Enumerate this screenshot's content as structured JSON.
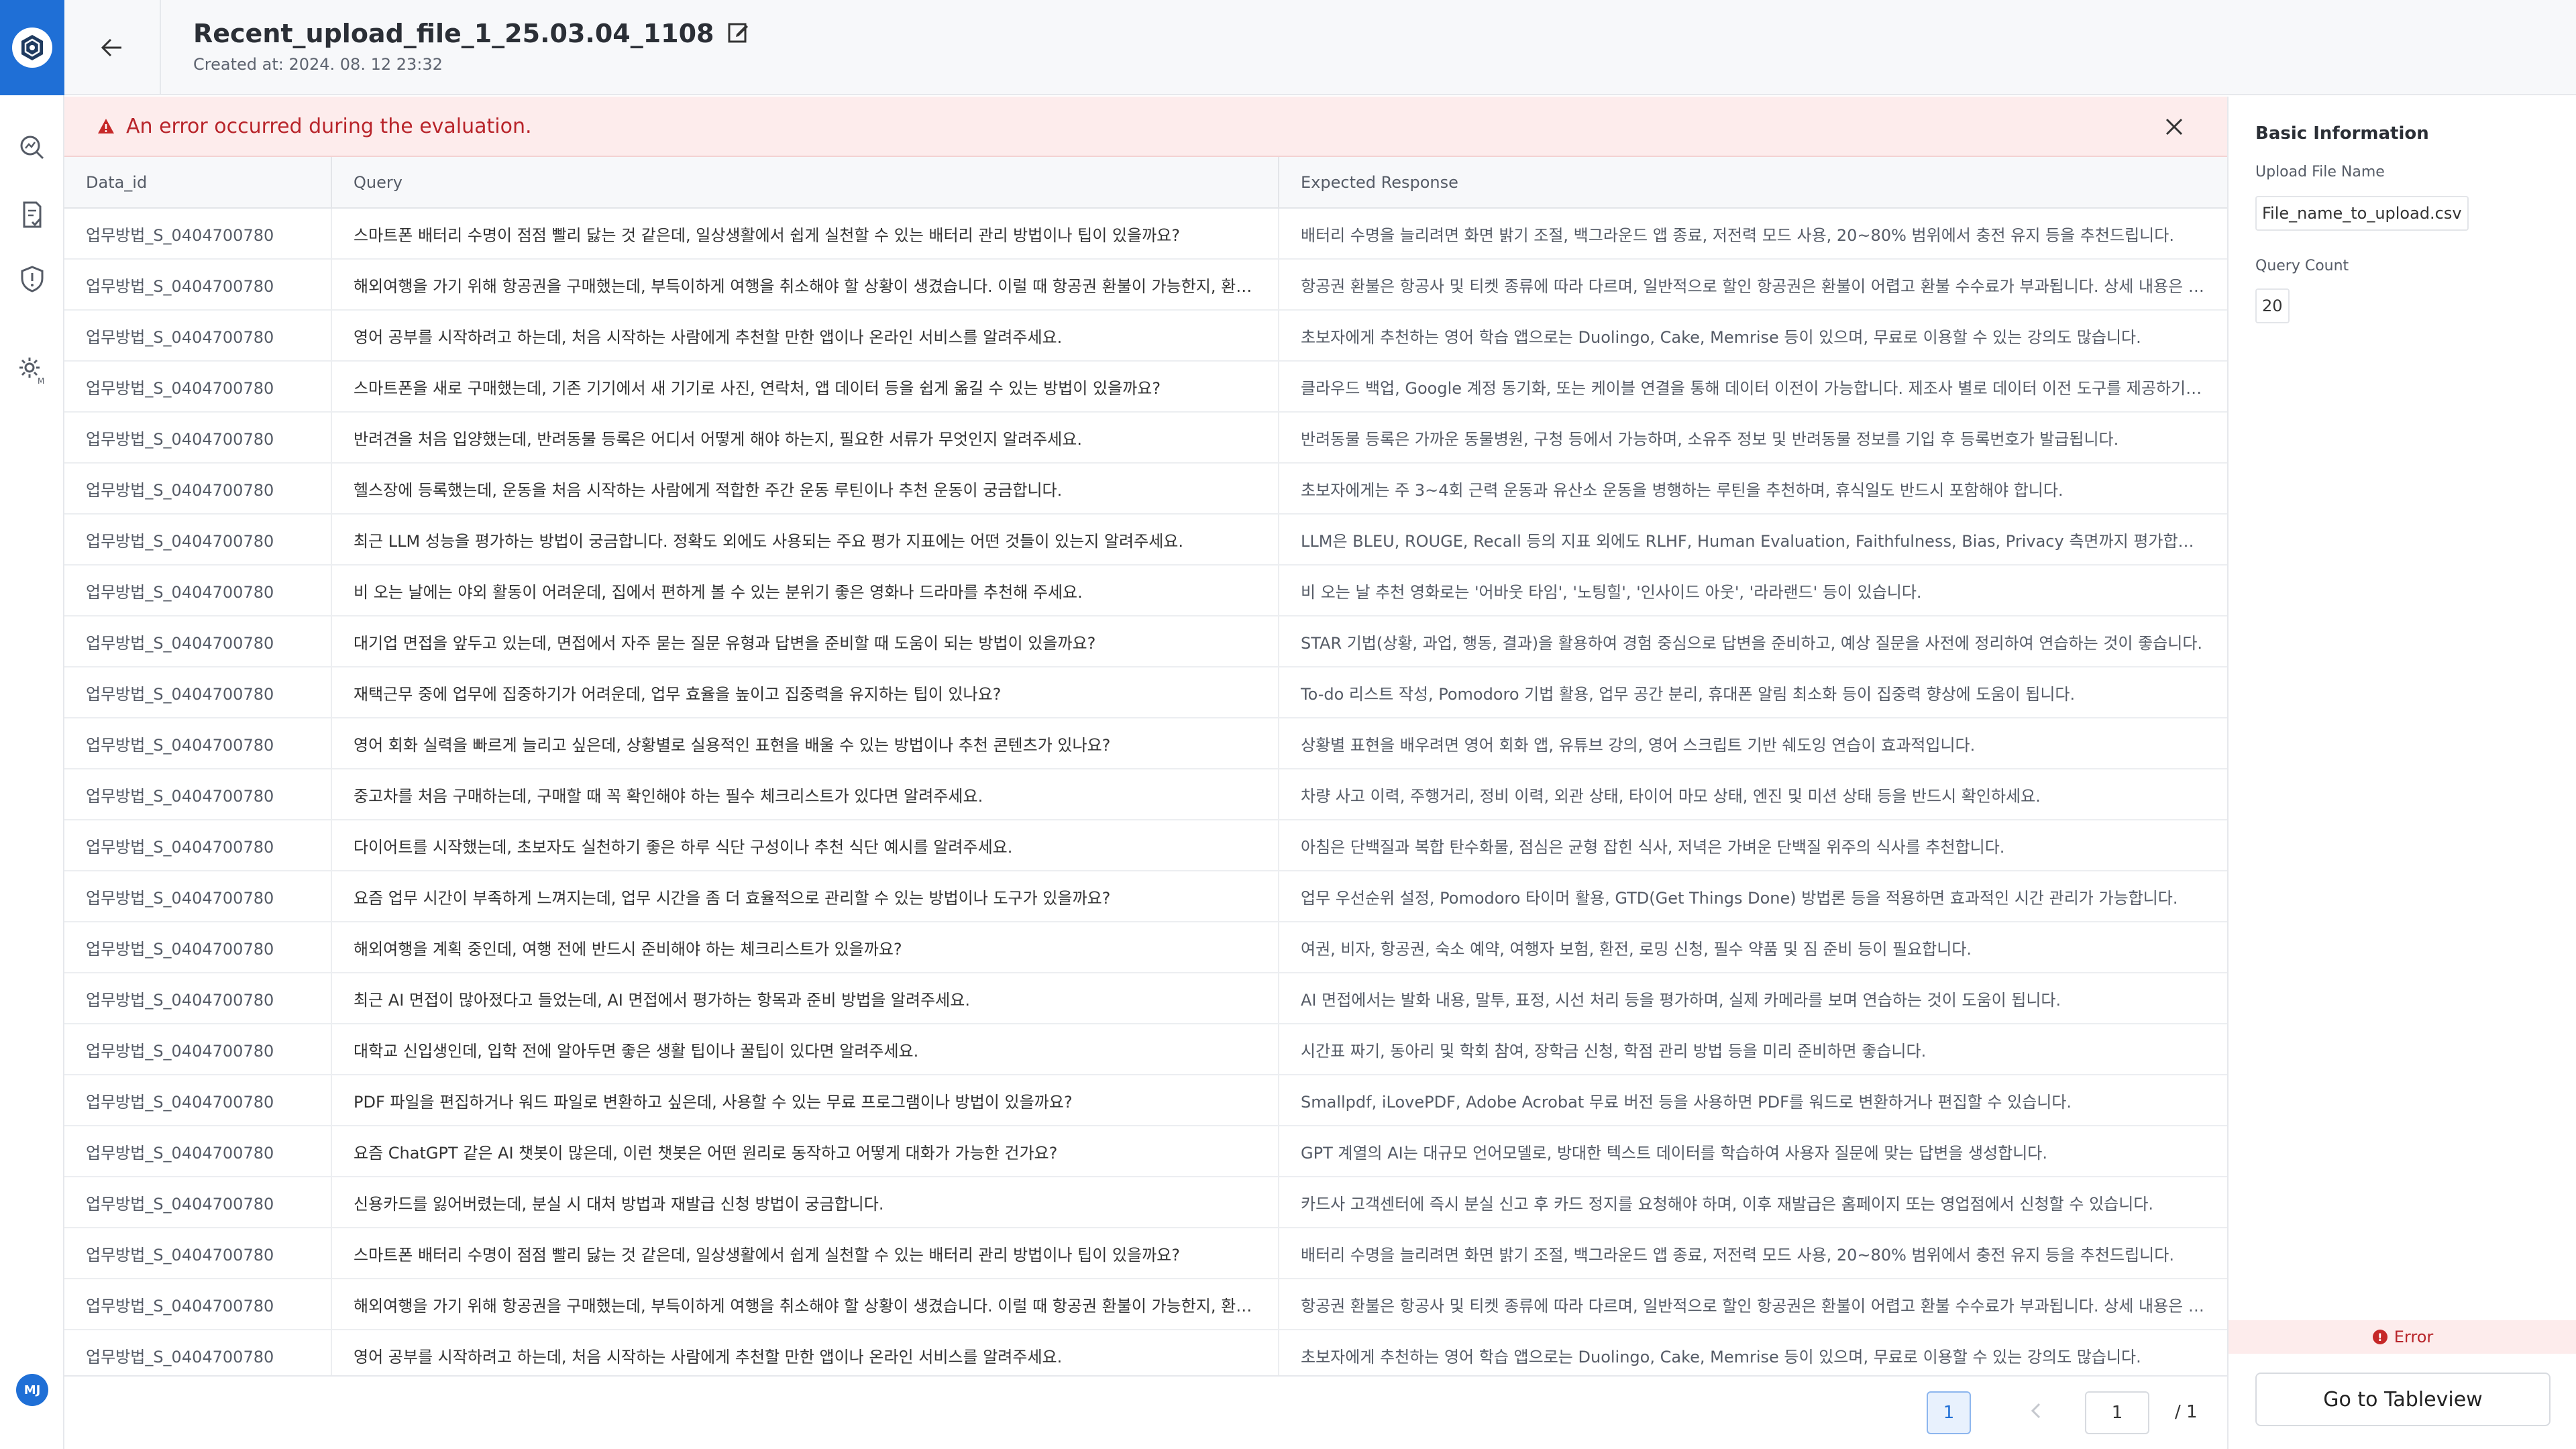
{
  "header": {
    "title": "Recent_upload_file_1_25.03.04_1108",
    "created_at": "Created at: 2024. 08. 12 23:32"
  },
  "error_banner": {
    "message": "An error occurred during the evaluation."
  },
  "table": {
    "columns": [
      "Data_id",
      "Query",
      "Expected Response"
    ],
    "rows": [
      {
        "id": "업무방법_S_0404700780",
        "query": "스마트폰 배터리 수명이 점점 빨리 닳는 것 같은데, 일상생활에서 쉽게 실천할 수 있는 배터리 관리 방법이나 팁이 있을까요?",
        "response": "배터리 수명을 늘리려면 화면 밝기 조절, 백그라운드 앱 종료, 저전력 모드 사용, 20~80% 범위에서 충전 유지 등을 추천드립니다."
      },
      {
        "id": "업무방법_S_0404700780",
        "query": "해외여행을 가기 위해 항공권을 구매했는데, 부득이하게 여행을 취소해야 할 상황이 생겼습니다. 이럴 때 항공권 환불이 가능한지, 환불 수…",
        "response": "항공권 환불은 항공사 및 티켓 종류에 따라 다르며, 일반적으로 할인 항공권은 환불이 어렵고 환불 수수료가 부과됩니다. 상세 내용은 구매…"
      },
      {
        "id": "업무방법_S_0404700780",
        "query": "영어 공부를 시작하려고 하는데, 처음 시작하는 사람에게 추천할 만한 앱이나 온라인 서비스를 알려주세요.",
        "response": "초보자에게 추천하는 영어 학습 앱으로는 Duolingo, Cake, Memrise 등이 있으며, 무료로 이용할 수 있는 강의도 많습니다."
      },
      {
        "id": "업무방법_S_0404700780",
        "query": "스마트폰을 새로 구매했는데, 기존 기기에서 새 기기로 사진, 연락처, 앱 데이터 등을 쉽게 옮길 수 있는 방법이 있을까요?",
        "response": "클라우드 백업, Google 계정 동기화, 또는 케이블 연결을 통해 데이터 이전이 가능합니다. 제조사 별로 데이터 이전 도구를 제공하기도 합…"
      },
      {
        "id": "업무방법_S_0404700780",
        "query": "반려견을 처음 입양했는데, 반려동물 등록은 어디서 어떻게 해야 하는지, 필요한 서류가 무엇인지 알려주세요.",
        "response": "반려동물 등록은 가까운 동물병원, 구청 등에서 가능하며, 소유주 정보 및 반려동물 정보를 기입 후 등록번호가 발급됩니다."
      },
      {
        "id": "업무방법_S_0404700780",
        "query": "헬스장에 등록했는데, 운동을 처음 시작하는 사람에게 적합한 주간 운동 루틴이나 추천 운동이 궁금합니다.",
        "response": "초보자에게는 주 3~4회 근력 운동과 유산소 운동을 병행하는 루틴을 추천하며, 휴식일도 반드시 포함해야 합니다."
      },
      {
        "id": "업무방법_S_0404700780",
        "query": "최근 LLM 성능을 평가하는 방법이 궁금합니다. 정확도 외에도 사용되는 주요 평가 지표에는 어떤 것들이 있는지 알려주세요.",
        "response": "LLM은 BLEU, ROUGE, Recall 등의 지표 외에도 RLHF, Human Evaluation, Faithfulness, Bias, Privacy 측면까지 평가합니다."
      },
      {
        "id": "업무방법_S_0404700780",
        "query": "비 오는 날에는 야외 활동이 어려운데, 집에서 편하게 볼 수 있는 분위기 좋은 영화나 드라마를 추천해 주세요.",
        "response": "비 오는 날 추천 영화로는 '어바웃 타임', '노팅힐', '인사이드 아웃', '라라랜드' 등이 있습니다."
      },
      {
        "id": "업무방법_S_0404700780",
        "query": "대기업 면접을 앞두고 있는데, 면접에서 자주 묻는 질문 유형과 답변을 준비할 때 도움이 되는 방법이 있을까요?",
        "response": "STAR 기법(상황, 과업, 행동, 결과)을 활용하여 경험 중심으로 답변을 준비하고, 예상 질문을 사전에 정리하여 연습하는 것이 좋습니다."
      },
      {
        "id": "업무방법_S_0404700780",
        "query": "재택근무 중에 업무에 집중하기가 어려운데, 업무 효율을 높이고 집중력을 유지하는 팁이 있나요?",
        "response": "To-do 리스트 작성, Pomodoro 기법 활용, 업무 공간 분리, 휴대폰 알림 최소화 등이 집중력 향상에 도움이 됩니다."
      },
      {
        "id": "업무방법_S_0404700780",
        "query": "영어 회화 실력을 빠르게 늘리고 싶은데, 상황별로 실용적인 표현을 배울 수 있는 방법이나 추천 콘텐츠가 있나요?",
        "response": "상황별 표현을 배우려면 영어 회화 앱, 유튜브 강의, 영어 스크립트 기반 쉐도잉 연습이 효과적입니다."
      },
      {
        "id": "업무방법_S_0404700780",
        "query": "중고차를 처음 구매하는데, 구매할 때 꼭 확인해야 하는 필수 체크리스트가 있다면 알려주세요.",
        "response": "차량 사고 이력, 주행거리, 정비 이력, 외관 상태, 타이어 마모 상태, 엔진 및 미션 상태 등을 반드시 확인하세요."
      },
      {
        "id": "업무방법_S_0404700780",
        "query": "다이어트를 시작했는데, 초보자도 실천하기 좋은 하루 식단 구성이나 추천 식단 예시를 알려주세요.",
        "response": "아침은 단백질과 복합 탄수화물, 점심은 균형 잡힌 식사, 저녁은 가벼운 단백질 위주의 식사를 추천합니다."
      },
      {
        "id": "업무방법_S_0404700780",
        "query": "요즘 업무 시간이 부족하게 느껴지는데, 업무 시간을 좀 더 효율적으로 관리할 수 있는 방법이나 도구가 있을까요?",
        "response": "업무 우선순위 설정, Pomodoro 타이머 활용, GTD(Get Things Done) 방법론 등을 적용하면 효과적인 시간 관리가 가능합니다."
      },
      {
        "id": "업무방법_S_0404700780",
        "query": "해외여행을 계획 중인데, 여행 전에 반드시 준비해야 하는 체크리스트가 있을까요?",
        "response": "여권, 비자, 항공권, 숙소 예약, 여행자 보험, 환전, 로밍 신청, 필수 약품 및 짐 준비 등이 필요합니다."
      },
      {
        "id": "업무방법_S_0404700780",
        "query": "최근 AI 면접이 많아졌다고 들었는데, AI 면접에서 평가하는 항목과 준비 방법을 알려주세요.",
        "response": "AI 면접에서는 발화 내용, 말투, 표정, 시선 처리 등을 평가하며, 실제 카메라를 보며 연습하는 것이 도움이 됩니다."
      },
      {
        "id": "업무방법_S_0404700780",
        "query": "대학교 신입생인데, 입학 전에 알아두면 좋은 생활 팁이나 꿀팁이 있다면 알려주세요.",
        "response": "시간표 짜기, 동아리 및 학회 참여, 장학금 신청, 학점 관리 방법 등을 미리 준비하면 좋습니다."
      },
      {
        "id": "업무방법_S_0404700780",
        "query": "PDF 파일을 편집하거나 워드 파일로 변환하고 싶은데, 사용할 수 있는 무료 프로그램이나 방법이 있을까요?",
        "response": "Smallpdf, iLovePDF, Adobe Acrobat 무료 버전 등을 사용하면 PDF를 워드로 변환하거나 편집할 수 있습니다."
      },
      {
        "id": "업무방법_S_0404700780",
        "query": "요즘 ChatGPT 같은 AI 챗봇이 많은데, 이런 챗봇은 어떤 원리로 동작하고 어떻게 대화가 가능한 건가요?",
        "response": "GPT 계열의 AI는 대규모 언어모델로, 방대한 텍스트 데이터를 학습하여 사용자 질문에 맞는 답변을 생성합니다."
      },
      {
        "id": "업무방법_S_0404700780",
        "query": "신용카드를 잃어버렸는데, 분실 시 대처 방법과 재발급 신청 방법이 궁금합니다.",
        "response": "카드사 고객센터에 즉시 분실 신고 후 카드 정지를 요청해야 하며, 이후 재발급은 홈페이지 또는 영업점에서 신청할 수 있습니다."
      },
      {
        "id": "업무방법_S_0404700780",
        "query": "스마트폰 배터리 수명이 점점 빨리 닳는 것 같은데, 일상생활에서 쉽게 실천할 수 있는 배터리 관리 방법이나 팁이 있을까요?",
        "response": "배터리 수명을 늘리려면 화면 밝기 조절, 백그라운드 앱 종료, 저전력 모드 사용, 20~80% 범위에서 충전 유지 등을 추천드립니다."
      },
      {
        "id": "업무방법_S_0404700780",
        "query": "해외여행을 가기 위해 항공권을 구매했는데, 부득이하게 여행을 취소해야 할 상황이 생겼습니다. 이럴 때 항공권 환불이 가능한지, 환불 수…",
        "response": "항공권 환불은 항공사 및 티켓 종류에 따라 다르며, 일반적으로 할인 항공권은 환불이 어렵고 환불 수수료가 부과됩니다. 상세 내용은 구매…"
      },
      {
        "id": "업무방법_S_0404700780",
        "query": "영어 공부를 시작하려고 하는데, 처음 시작하는 사람에게 추천할 만한 앱이나 온라인 서비스를 알려주세요.",
        "response": "초보자에게 추천하는 영어 학습 앱으로는 Duolingo, Cake, Memrise 등이 있으며, 무료로 이용할 수 있는 강의도 많습니다."
      }
    ]
  },
  "pagination": {
    "current_page": "1",
    "page_input": "1",
    "total": "/ 1"
  },
  "panel": {
    "title": "Basic Information",
    "file_name_label": "Upload File Name",
    "file_name_value": "File_name_to_upload.csv",
    "query_count_label": "Query Count",
    "query_count_value": "20",
    "status_text": "Error",
    "goto_button": "Go to Tableview"
  },
  "user": {
    "avatar_initials": "MJ"
  },
  "colors": {
    "accent": "#1f6fd6",
    "error": "#b8242a",
    "error_bg": "#fdecec"
  },
  "icons": {
    "rail": [
      "logo-icon",
      "analytics-icon",
      "document-check-icon",
      "shield-icon",
      "settings-icon"
    ],
    "header": [
      "back-arrow-icon",
      "edit-icon"
    ],
    "banner": [
      "warning-icon",
      "close-icon"
    ],
    "pagination": [
      "chevron-left-icon",
      "chevron-left-icon"
    ]
  }
}
